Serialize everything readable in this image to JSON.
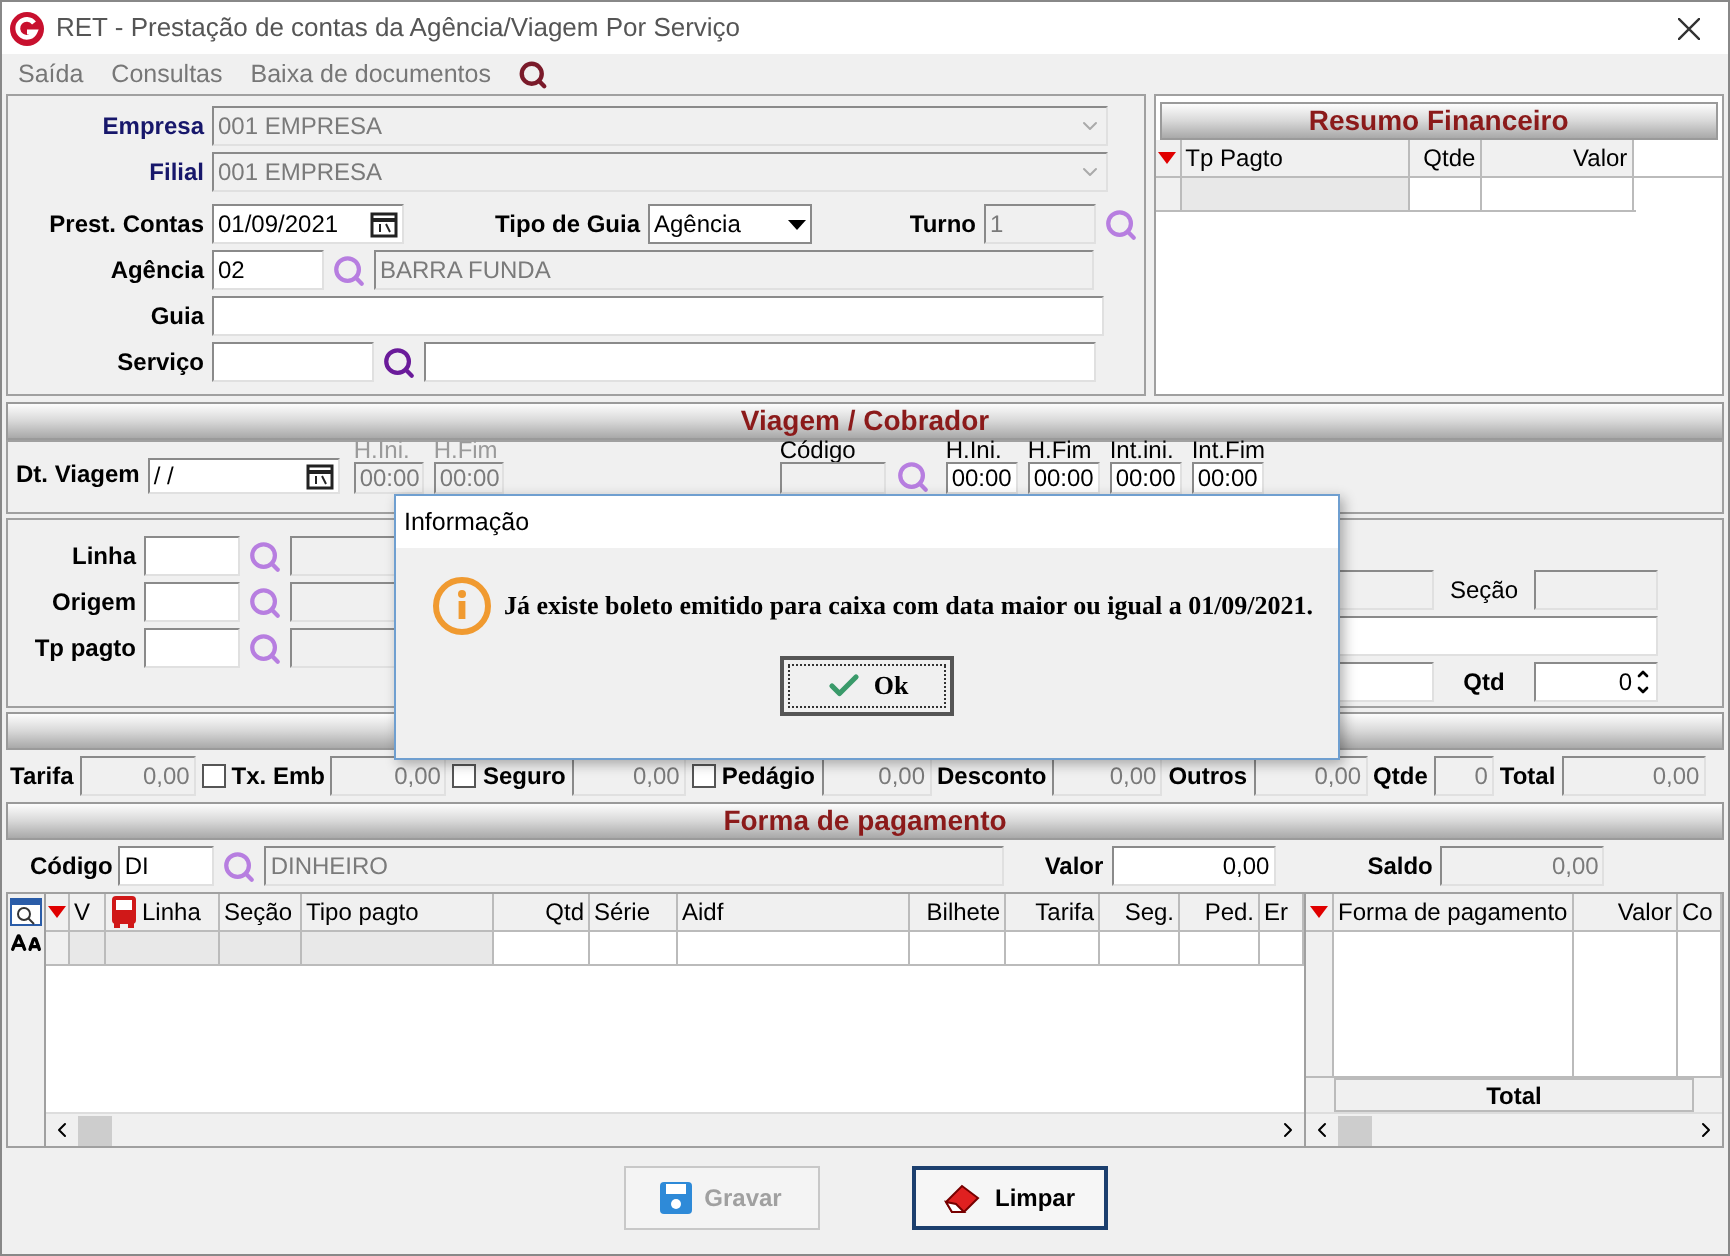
{
  "window": {
    "title": "RET - Prestação de contas da Agência/Viagem Por Serviço"
  },
  "menu": [
    "Saída",
    "Consultas",
    "Baixa de documentos"
  ],
  "top_form": {
    "empresa": {
      "label": "Empresa",
      "value": "001 EMPRESA"
    },
    "filial": {
      "label": "Filial",
      "value": "001 EMPRESA"
    },
    "prest_contas": {
      "label": "Prest. Contas",
      "value": "01/09/2021"
    },
    "tipo_guia": {
      "label": "Tipo de Guia",
      "value": "Agência"
    },
    "turno": {
      "label": "Turno",
      "value": "1"
    },
    "agencia": {
      "label": "Agência",
      "value": "02",
      "description": "BARRA FUNDA"
    },
    "guia": {
      "label": "Guia"
    },
    "servico": {
      "label": "Serviço"
    }
  },
  "resumo": {
    "title": "Resumo Financeiro",
    "columns": [
      "Tp Pagto",
      "Qtde",
      "Valor"
    ]
  },
  "viagem": {
    "title": "Viagem / Cobrador",
    "dt_viagem": {
      "label": "Dt. Viagem",
      "value": " /  /"
    },
    "times_left": [
      {
        "label": "H.Ini.",
        "value": "00:00"
      },
      {
        "label": "H.Fim",
        "value": "00:00"
      }
    ],
    "codigo": {
      "label": "Código"
    },
    "times_right": [
      {
        "label": "H.Ini.",
        "value": "00:00"
      },
      {
        "label": "H.Fim",
        "value": "00:00"
      },
      {
        "label": "Int.ini.",
        "value": "00:00"
      },
      {
        "label": "Int.Fim",
        "value": "00:00"
      }
    ]
  },
  "trip": {
    "lookups": [
      "Linha",
      "Origem",
      "Tp pagto"
    ],
    "secao": {
      "label": "Seção"
    },
    "qtd": {
      "label": "Qtd",
      "value": "0"
    }
  },
  "totals": [
    {
      "kind": "field",
      "label": "Tarifa",
      "value": "0,00"
    },
    {
      "kind": "check",
      "label": "Tx. Emb",
      "value": "0,00",
      "checked": false
    },
    {
      "kind": "check",
      "label": "Seguro",
      "value": "0,00",
      "checked": false
    },
    {
      "kind": "check",
      "label": "Pedágio",
      "value": "0,00",
      "checked": false
    },
    {
      "kind": "field",
      "label": "Desconto",
      "value": "0,00"
    },
    {
      "kind": "field",
      "label": "Outros",
      "value": "0,00"
    },
    {
      "kind": "field",
      "label": "Qtde",
      "value": "0"
    },
    {
      "kind": "field",
      "label": "Total",
      "value": "0,00"
    }
  ],
  "pagamento": {
    "title": "Forma de pagamento",
    "codigo": {
      "label": "Código",
      "value": "DI",
      "description": "DINHEIRO"
    },
    "valor": {
      "label": "Valor",
      "value": "0,00"
    },
    "saldo": {
      "label": "Saldo",
      "value": "0,00"
    }
  },
  "items_grid": {
    "columns": [
      "V",
      "Linha",
      "Seção",
      "Tipo pagto",
      "Qtd",
      "Série",
      "Aidf",
      "Bilhete",
      "Tarifa",
      "Seg.",
      "Ped.",
      "Er"
    ]
  },
  "payments_grid": {
    "columns": [
      "Forma de pagamento",
      "Valor",
      "Co"
    ],
    "footer": "Total"
  },
  "buttons": [
    {
      "label": "Gravar",
      "disabled": true
    },
    {
      "label": "Limpar",
      "disabled": false
    }
  ],
  "dialog": {
    "title": "Informação",
    "message": "Já existe boleto emitido para caixa com data maior ou igual a 01/09/2021.",
    "button": "Ok"
  }
}
